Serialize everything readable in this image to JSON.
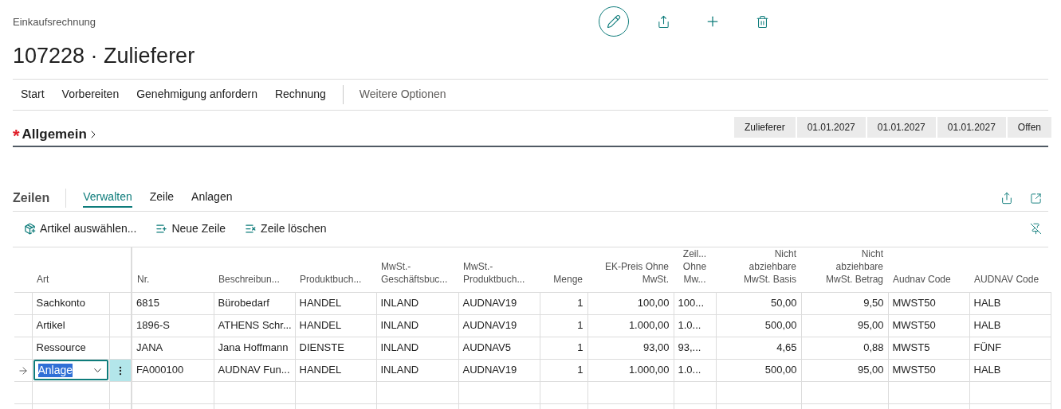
{
  "breadcrumb": "Einkaufsrechnung",
  "title": "107228 · Zulieferer",
  "actions": [
    {
      "kind": "edit"
    },
    {
      "kind": "share"
    },
    {
      "kind": "new"
    },
    {
      "kind": "delete"
    }
  ],
  "action_menu": [
    {
      "label": "Start"
    },
    {
      "label": "Vorbereiten"
    },
    {
      "label": "Genehmigung anfordern"
    },
    {
      "label": "Rechnung"
    }
  ],
  "more_options": "Weitere Optionen",
  "section": {
    "title": "Allgemein",
    "required_mark": "*",
    "expanded": false,
    "summary": [
      "Zulieferer",
      "01.01.2027",
      "01.01.2027",
      "01.01.2027",
      "Offen"
    ]
  },
  "lines": {
    "title": "Zeilen",
    "tabs": [
      {
        "label": "Verwalten",
        "selected": true
      },
      {
        "label": "Zeile",
        "selected": false
      },
      {
        "label": "Anlagen",
        "selected": false
      }
    ],
    "toolbar": [
      {
        "label": "Artikel auswählen...",
        "kind": "pick"
      },
      {
        "label": "Neue Zeile",
        "kind": "new"
      },
      {
        "label": "Zeile löschen",
        "kind": "delete"
      }
    ],
    "table": {
      "columns": [
        {
          "label": "Art"
        },
        {
          "label": "Nr."
        },
        {
          "label": "Beschreibun..."
        },
        {
          "label": "Produktbuch..."
        },
        {
          "label": "MwSt.-\nGeschäftsbuc..."
        },
        {
          "label": "MwSt.-\nProduktbuch..."
        },
        {
          "label": "Menge"
        },
        {
          "label": "EK-Preis Ohne\nMwSt."
        },
        {
          "label": "Zeil...\nOhne\nMw..."
        },
        {
          "label": "Nicht\nabziehbare\nMwSt. Basis"
        },
        {
          "label": "Nicht\nabziehbare\nMwSt. Betrag"
        },
        {
          "label": "Audnav Code"
        },
        {
          "label": "AUDNAV Code"
        }
      ],
      "rows": [
        {
          "selected": false,
          "cells": [
            "Sachkonto",
            "6815",
            "Bürobedarf",
            "HANDEL",
            "INLAND",
            "AUDNAV19",
            "1",
            "100,00",
            "100...",
            "50,00",
            "9,50",
            "MWST50",
            "HALB"
          ]
        },
        {
          "selected": false,
          "cells": [
            "Artikel",
            "1896-S",
            "ATHENS Schr...",
            "HANDEL",
            "INLAND",
            "AUDNAV19",
            "1",
            "1.000,00",
            "1.0...",
            "500,00",
            "95,00",
            "MWST50",
            "HALB"
          ]
        },
        {
          "selected": false,
          "cells": [
            "Ressource",
            "JANA",
            "Jana Hoffmann",
            "DIENSTE",
            "INLAND",
            "AUDNAV5",
            "1",
            "93,00",
            "93,...",
            "4,65",
            "0,88",
            "MWST5",
            "FÜNF"
          ]
        },
        {
          "selected": true,
          "cells": [
            "Anlage",
            "FA000100",
            "AUDNAV Fun...",
            "HANDEL",
            "INLAND",
            "AUDNAV19",
            "1",
            "1.000,00",
            "1.0...",
            "500,00",
            "95,00",
            "MWST50",
            "HALB"
          ]
        }
      ]
    }
  }
}
